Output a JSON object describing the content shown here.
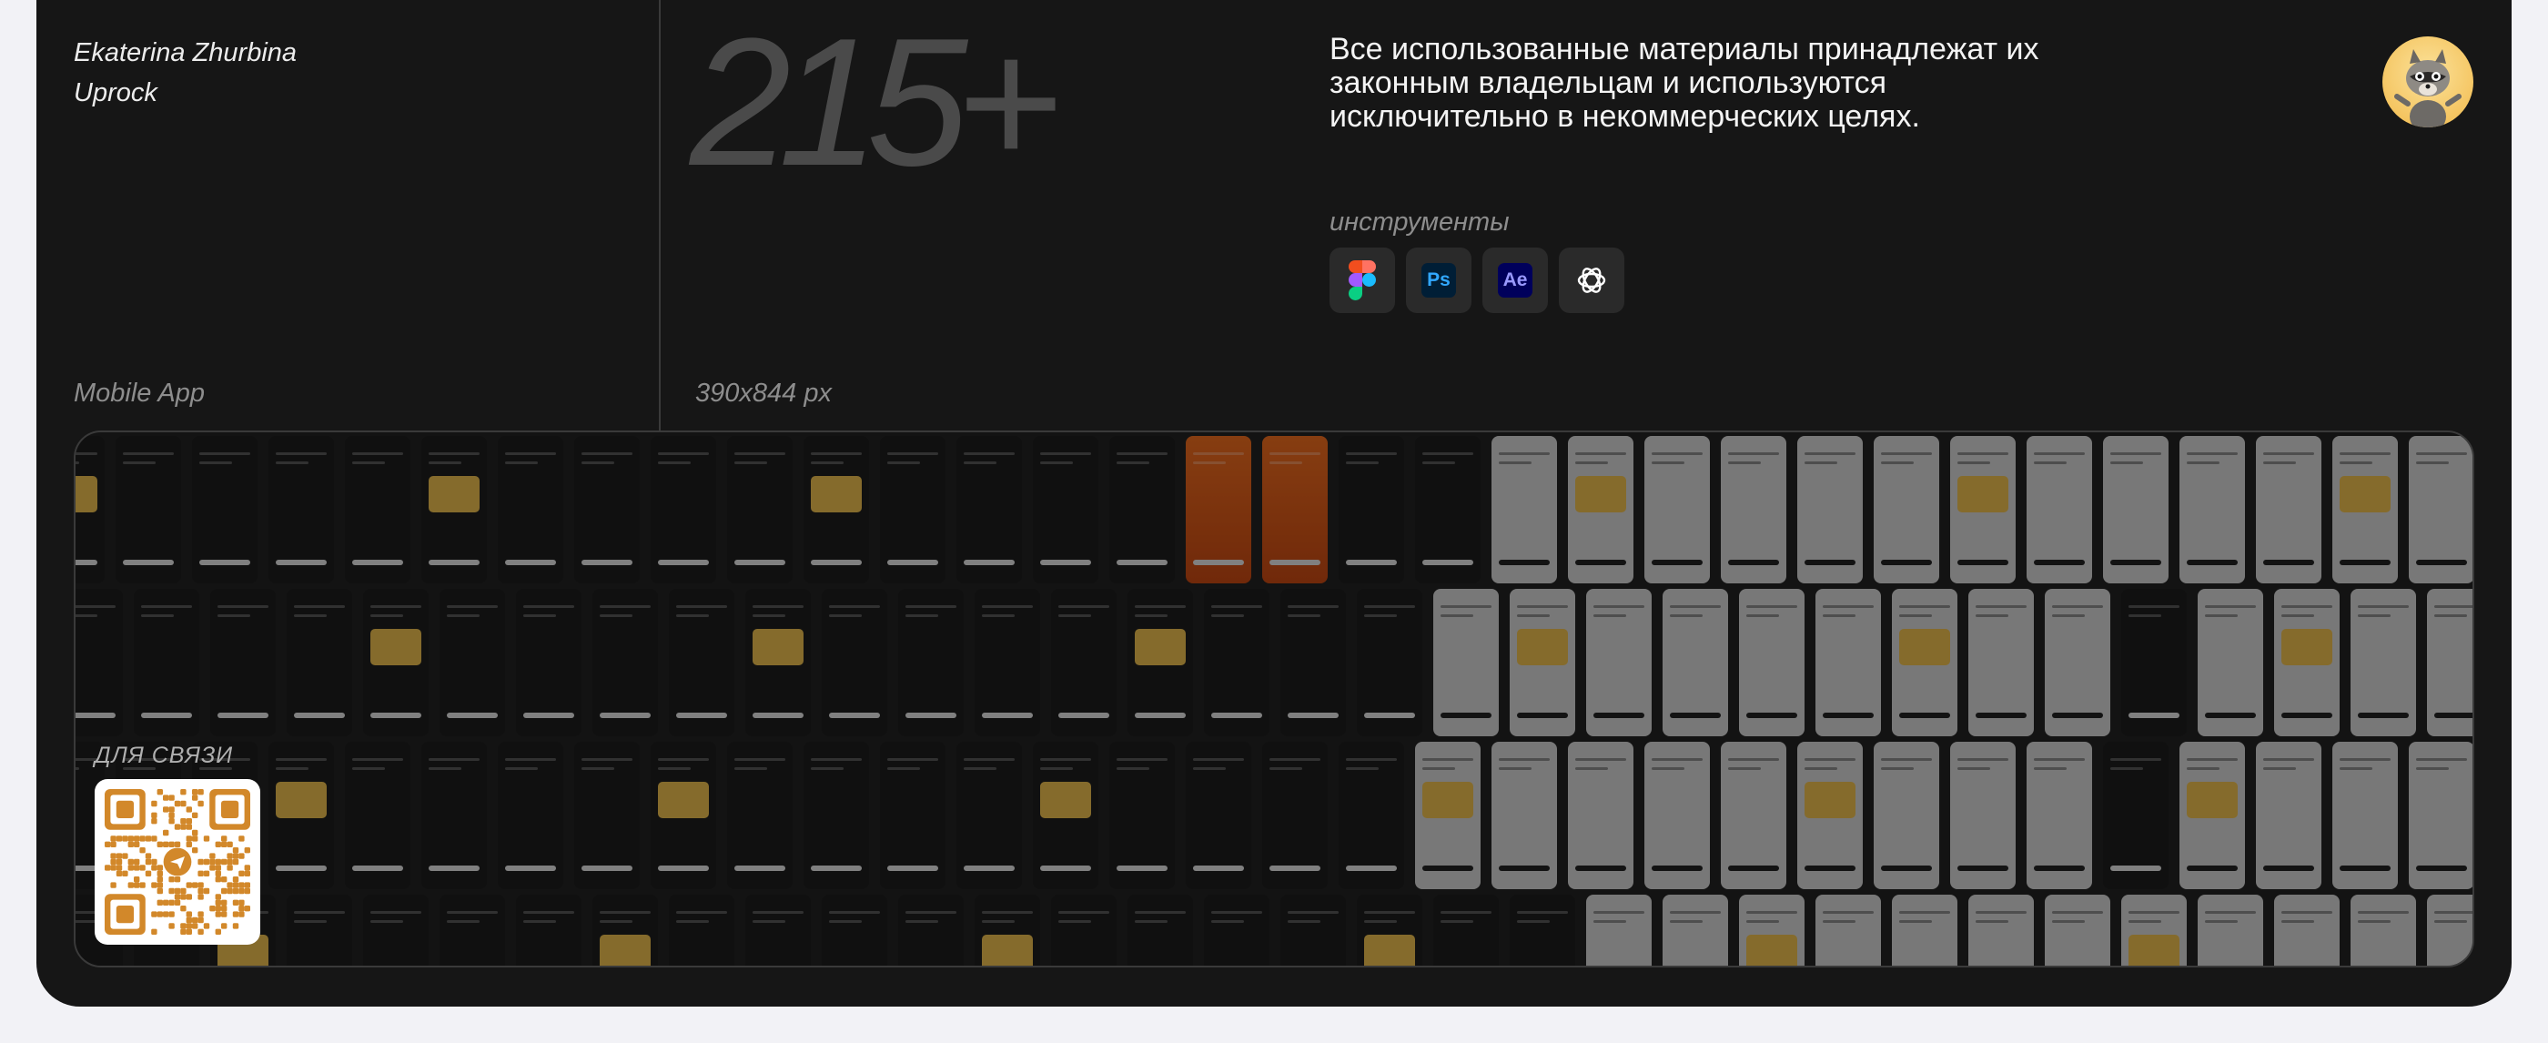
{
  "author": {
    "name": "Ekaterina Zhurbina",
    "company": "Uprock"
  },
  "project": {
    "type_label": "Mobile App",
    "screen_size_label": "390x844 px",
    "screens_count": "215+"
  },
  "notice": "Все использованные материалы принадлежат их законным владельцам и используются исключительно в некоммерческих целях.",
  "tools": {
    "label": "инструменты",
    "items": [
      {
        "name": "figma",
        "icon": "figma-icon"
      },
      {
        "name": "photoshop",
        "icon": "photoshop-icon",
        "text": "Ps"
      },
      {
        "name": "after-effects",
        "icon": "after-effects-icon",
        "text": "Ae"
      },
      {
        "name": "chatgpt",
        "icon": "chatgpt-icon"
      }
    ]
  },
  "contact": {
    "label": "ДЛЯ СВЯЗИ",
    "qr_icon": "telegram-qr-code"
  },
  "colors": {
    "card_bg": "#161616",
    "page_bg": "#f2f2f6",
    "accent": "#d2882a"
  }
}
